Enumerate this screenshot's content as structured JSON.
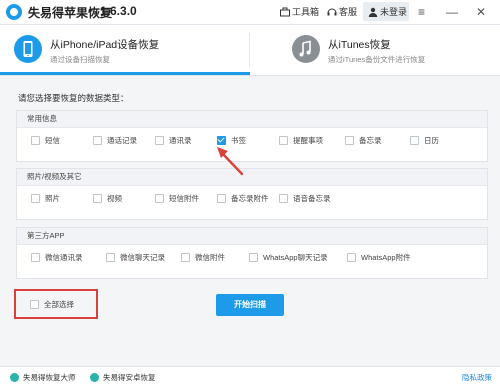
{
  "app": {
    "title": "失易得苹果恢复",
    "version": "1.6.3.0"
  },
  "toolbar": {
    "toolbox": "工具箱",
    "service": "客服",
    "user": "未登录"
  },
  "modes": [
    {
      "title": "从iPhone/iPad设备恢复",
      "subtitle": "通过设备扫描恢复",
      "active": true
    },
    {
      "title": "从iTunes恢复",
      "subtitle": "通过iTunes备份文件进行恢复",
      "active": false
    }
  ],
  "prompt": "请您选择要恢复的数据类型：",
  "sections": [
    {
      "title": "常用信息",
      "options": [
        {
          "label": "短信",
          "checked": false
        },
        {
          "label": "通话记录",
          "checked": false
        },
        {
          "label": "通讯录",
          "checked": false
        },
        {
          "label": "书签",
          "checked": true
        },
        {
          "label": "提醒事项",
          "checked": false
        },
        {
          "label": "备忘录",
          "checked": false
        },
        {
          "label": "日历",
          "checked": false
        }
      ]
    },
    {
      "title": "照片/视频及其它",
      "options": [
        {
          "label": "照片",
          "checked": false
        },
        {
          "label": "视频",
          "checked": false
        },
        {
          "label": "短信附件",
          "checked": false
        },
        {
          "label": "备忘录附件",
          "checked": false
        },
        {
          "label": "语音备忘录",
          "checked": false
        }
      ]
    },
    {
      "title": "第三方APP",
      "options": [
        {
          "label": "微信通讯录",
          "checked": false
        },
        {
          "label": "微信聊天记录",
          "checked": false
        },
        {
          "label": "微信附件",
          "checked": false
        },
        {
          "label": "WhatsApp聊天记录",
          "checked": false
        },
        {
          "label": "WhatsApp附件",
          "checked": false
        }
      ]
    }
  ],
  "select_all": {
    "label": "全部选择",
    "checked": false
  },
  "scan_button": "开始扫描",
  "footer": {
    "link1": "失易得恢复大师",
    "link2": "失易得安卓恢复",
    "privacy": "隐私政策"
  },
  "colors": {
    "accent": "#1e9be8",
    "highlight": "#d9413c"
  }
}
